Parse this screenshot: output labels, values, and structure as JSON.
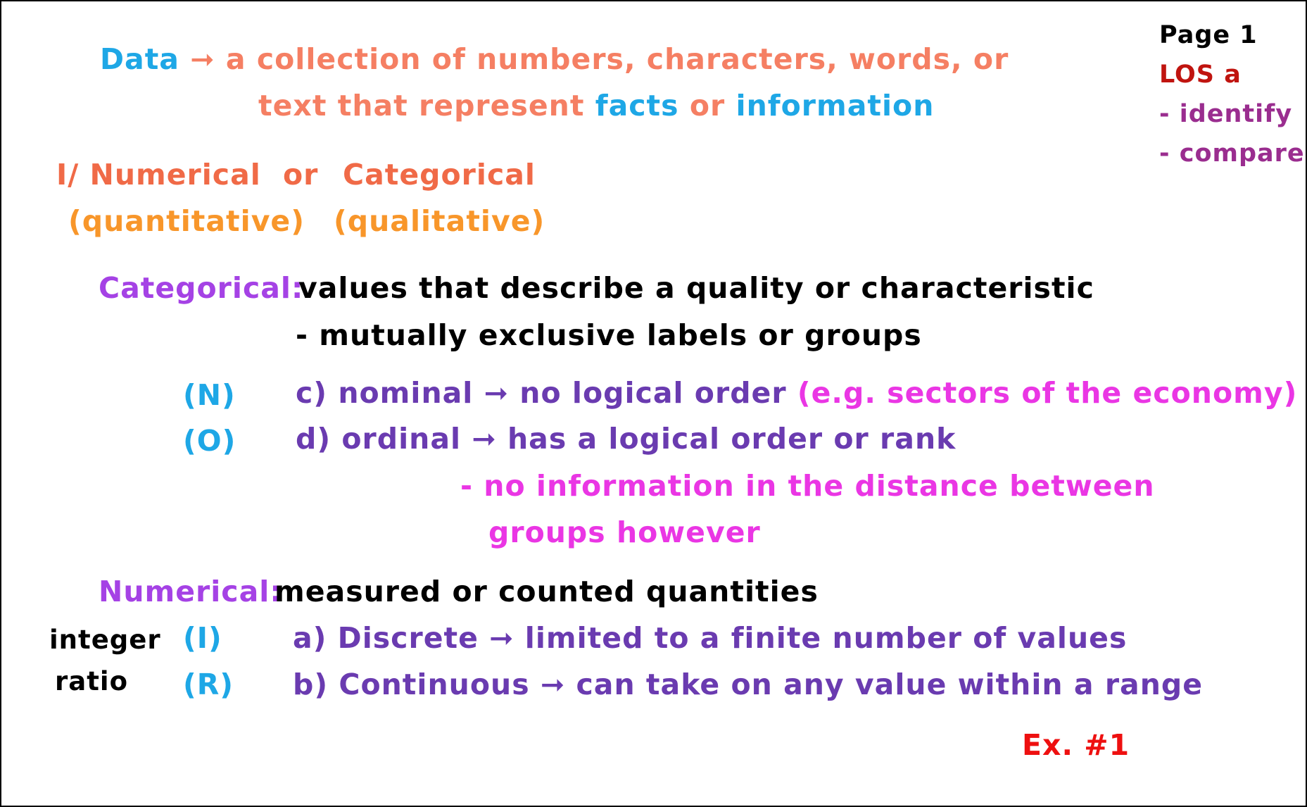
{
  "page_label": "Page 1",
  "los": {
    "title": "LOS a",
    "items": [
      "- identify",
      "- compare"
    ]
  },
  "definition": {
    "term": "Data",
    "arrow": "➞",
    "text1": "a collection of numbers, characters, words, or",
    "text2": "text that represent",
    "facts": "facts",
    "or": "or",
    "information": "information"
  },
  "split": {
    "label1": "I/ Numerical",
    "or": "or",
    "label2": "Categorical",
    "sub1": "(quantitative)",
    "sub2": "(qualitative)"
  },
  "categorical": {
    "heading": "Categorical:",
    "desc1": "values that describe a quality or characteristic",
    "desc2": "- mutually exclusive labels or groups",
    "nominal_tag": "(N)",
    "nominal_text": "c) nominal ➞ no logical order",
    "nominal_example": "(e.g. sectors of the economy)",
    "ordinal_tag": "(O)",
    "ordinal_text": "d) ordinal ➞ has a logical order or rank",
    "ordinal_note1": "- no information in the distance between",
    "ordinal_note2": "groups however"
  },
  "numerical": {
    "heading": "Numerical:",
    "desc": "measured or counted quantities",
    "side1": "integer",
    "side2": "ratio",
    "discrete_tag": "(I)",
    "discrete_text": "a) Discrete ➞ limited to a finite number of values",
    "continuous_tag": "(R)",
    "continuous_text": "b) Continuous ➞ can take on any value within a range"
  },
  "example": "Ex. #1",
  "colors": {
    "blue": "#1ea7e6",
    "salmon": "#f57f63",
    "orange": "#f8962a",
    "dark_red": "#c0140f",
    "red": "#ee1010",
    "purple": "#6a3bb0",
    "violet": "#a542e5",
    "magenta": "#ea36e4",
    "plum": "#9a2d8f"
  }
}
